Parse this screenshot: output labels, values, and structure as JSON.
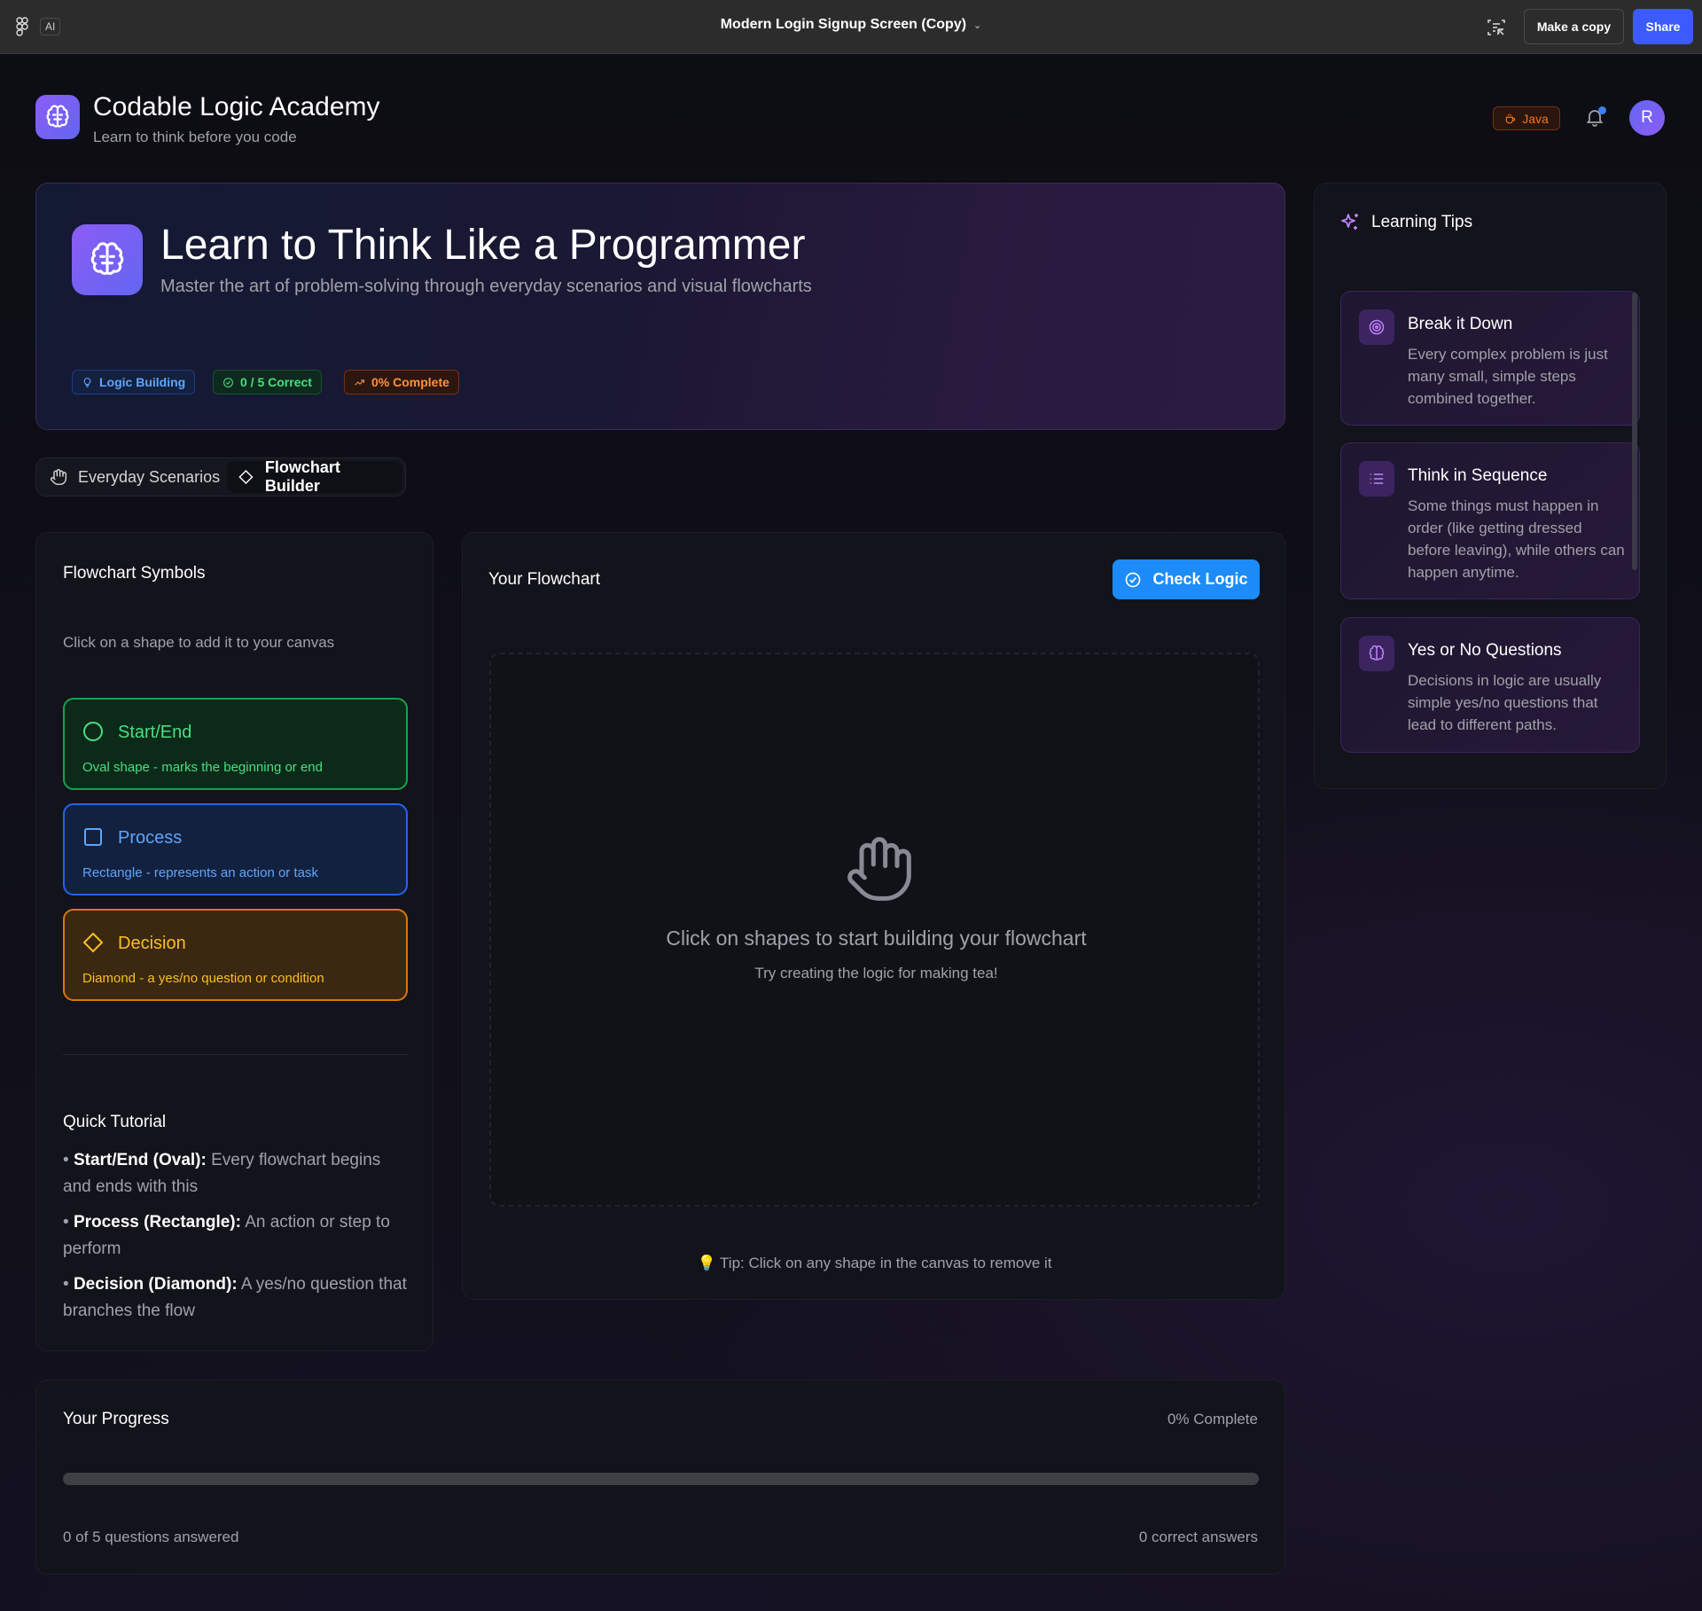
{
  "figma": {
    "ai_label": "AI",
    "file_title": "Modern Login Signup Screen (Copy)",
    "make_copy": "Make a copy",
    "share": "Share"
  },
  "header": {
    "brand_name": "Codable Logic Academy",
    "brand_tagline": "Learn to think before you code",
    "language_badge": "Java",
    "avatar_initial": "R"
  },
  "hero": {
    "title": "Learn to Think Like a Programmer",
    "subtitle": "Master the art of problem-solving through everyday scenarios and visual flowcharts",
    "badges": [
      "Logic Building",
      "0 / 5 Correct",
      "0% Complete"
    ]
  },
  "tabs": [
    "Everyday Scenarios",
    "Flowchart Builder"
  ],
  "symbols": {
    "title": "Flowchart Symbols",
    "hint": "Click on a shape to add it to your canvas",
    "shapes": [
      {
        "name": "Start/End",
        "desc": "Oval shape - marks the beginning or end"
      },
      {
        "name": "Process",
        "desc": "Rectangle - represents an action or task"
      },
      {
        "name": "Decision",
        "desc": "Diamond - a yes/no question or condition"
      }
    ],
    "tutorial_title": "Quick Tutorial",
    "tutorial": [
      {
        "term": "Start/End (Oval):",
        "text": "Every flowchart begins and ends with this"
      },
      {
        "term": "Process (Rectangle):",
        "text": "An action or step to perform"
      },
      {
        "term": "Decision (Diamond):",
        "text": "A yes/no question that branches the flow"
      }
    ]
  },
  "flowchart": {
    "title": "Your Flowchart",
    "check_button": "Check Logic",
    "empty_message": "Click on shapes to start building your flowchart",
    "empty_sub": "Try creating the logic for making tea!",
    "tip": "Tip: Click on any shape in the canvas to remove it"
  },
  "progress": {
    "title": "Your Progress",
    "percent_label": "0% Complete",
    "percent_value": 0,
    "answered": "0 of 5 questions answered",
    "correct": "0 correct answers"
  },
  "tips": {
    "title": "Learning Tips",
    "items": [
      {
        "title": "Break it Down",
        "text": "Every complex problem is just many small, simple steps combined together."
      },
      {
        "title": "Think in Sequence",
        "text": "Some things must happen in order (like getting dressed before leaving), while others can happen anytime."
      },
      {
        "title": "Yes or No Questions",
        "text": "Decisions in logic are usually simple yes/no questions that lead to different paths."
      }
    ]
  },
  "colors": {
    "accent": "#1d8cf8",
    "brand": "#8b5cf6",
    "start": "#4ade80",
    "process": "#60a5fa",
    "decision": "#fbbf24"
  }
}
